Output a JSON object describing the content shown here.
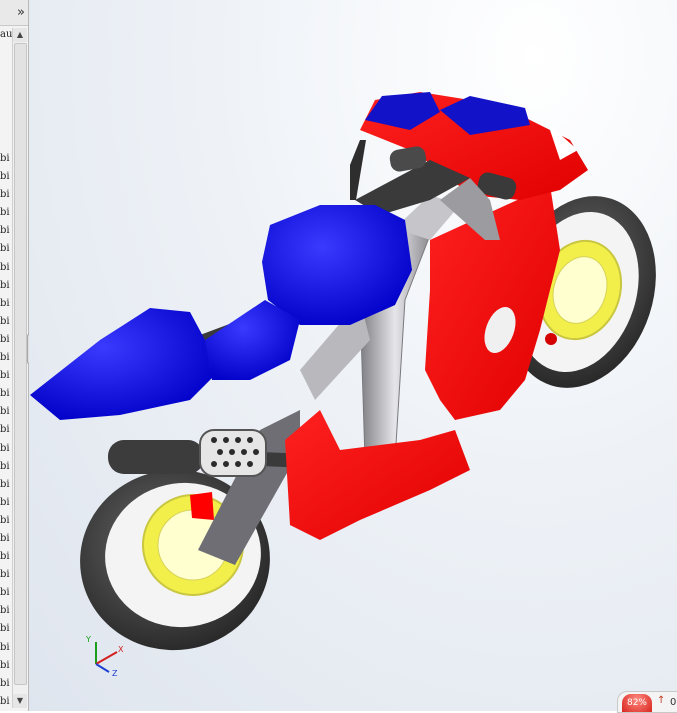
{
  "tree": {
    "expand_glyph": "»",
    "header": "au",
    "items": [
      "bi",
      "bi",
      "bi",
      "bi",
      "bi",
      "bi",
      "bi",
      "bi",
      "bi",
      "bi",
      "bi",
      "bi",
      "bi",
      "bi",
      "bi",
      "bi",
      "bi",
      "bi",
      "bi",
      "bi",
      "bi",
      "bi",
      "bi",
      "bi",
      "bi",
      "bi",
      "bi",
      "bi",
      "bi",
      "bi",
      "bi"
    ],
    "scroll_up": "▲",
    "scroll_down": "▼",
    "grip": "◂◂"
  },
  "triad": {
    "y": "Y",
    "x": "X",
    "z": "Z"
  },
  "status": {
    "zoom": "82%",
    "value": "0"
  },
  "colors": {
    "fairing_red": "#ff0000",
    "seat_blue": "#0000ee",
    "rim_yellow": "#f2ef4a",
    "tire_dark": "#3a3a3a",
    "frame_grey": "#a9a9ad"
  }
}
